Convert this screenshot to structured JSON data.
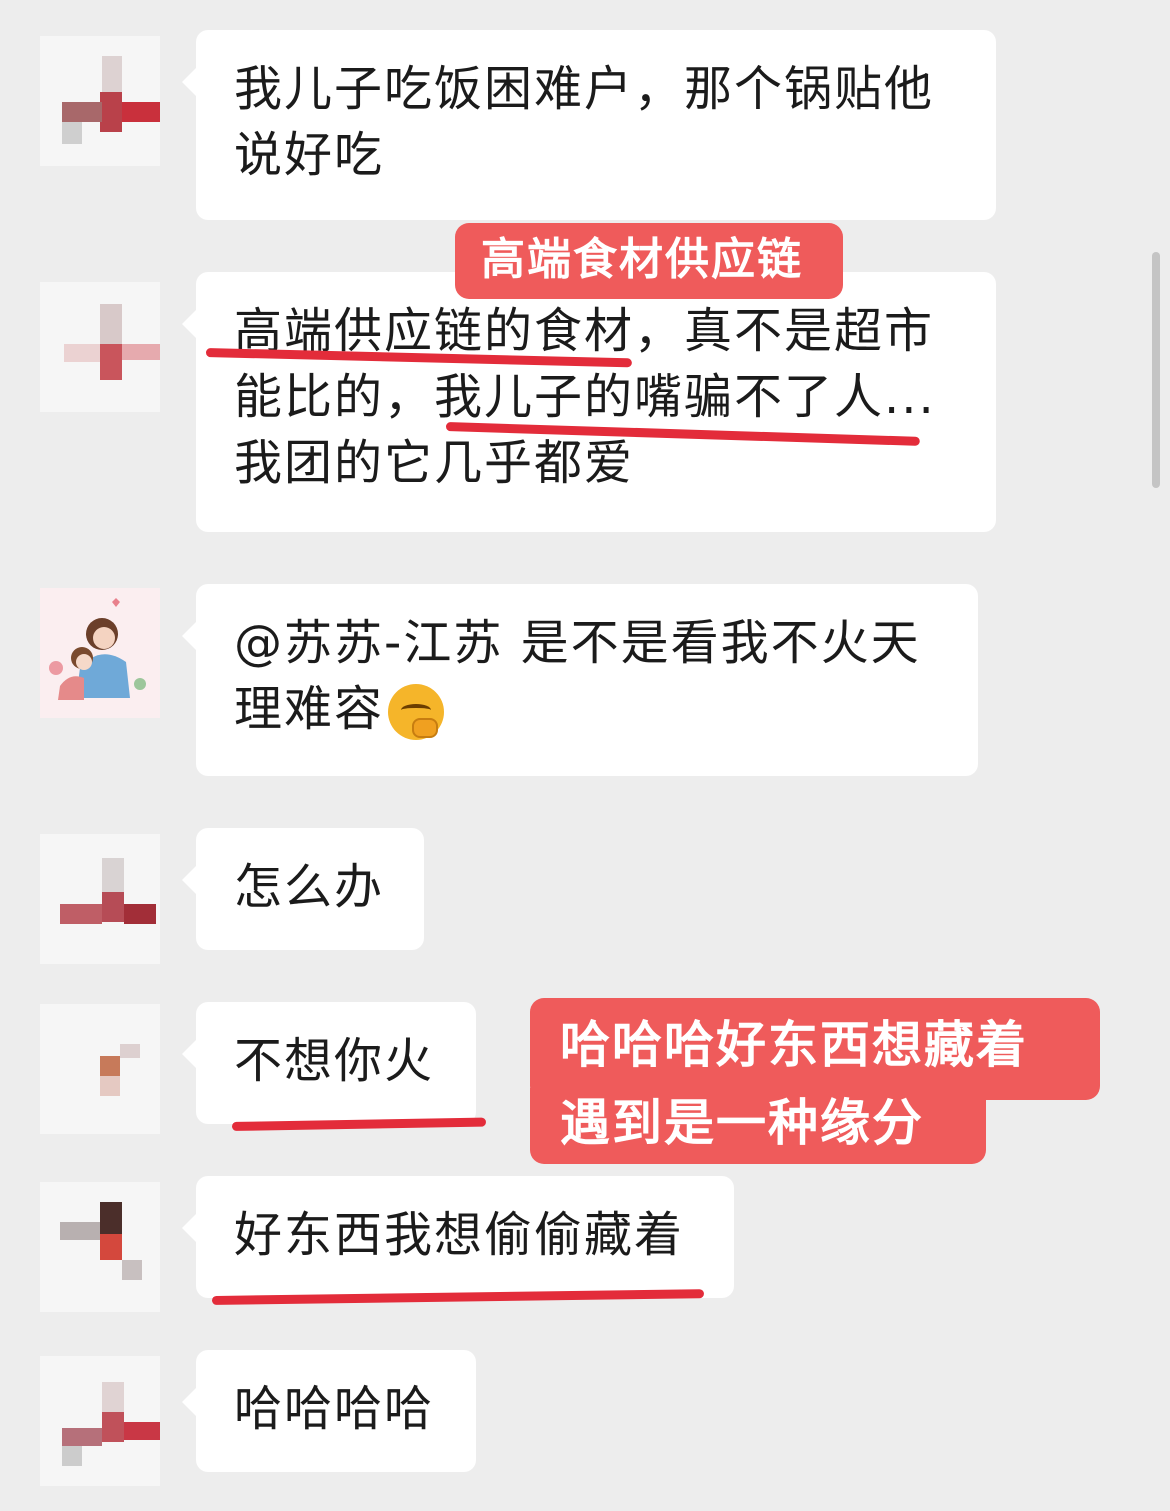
{
  "messages": [
    {
      "lines": [
        "我儿子吃饭困难户，那个锅贴他",
        "说好吃"
      ]
    },
    {
      "lines": [
        "高端供应链的食材，真不是超市",
        "能比的，我儿子的嘴骗不了人...",
        "我团的它几乎都爱"
      ]
    },
    {
      "lines": [
        "@苏苏-江苏 是不是看我不火天",
        "理难容"
      ],
      "emoji": "thinking-face-icon"
    },
    {
      "lines": [
        "怎么办"
      ]
    },
    {
      "lines": [
        "不想你火"
      ]
    },
    {
      "lines": [
        "好东西我想偷偷藏着"
      ]
    },
    {
      "lines": [
        "哈哈哈哈"
      ]
    }
  ],
  "annotations": {
    "top_label": "高端食材供应链",
    "side_note_lines": [
      "哈哈哈好东西想藏着",
      "遇到是一种缘分"
    ]
  },
  "colors": {
    "annotation_bg": "#ef5b5b",
    "underline": "#e32c3a",
    "bubble": "#ffffff",
    "background": "#ededed"
  }
}
